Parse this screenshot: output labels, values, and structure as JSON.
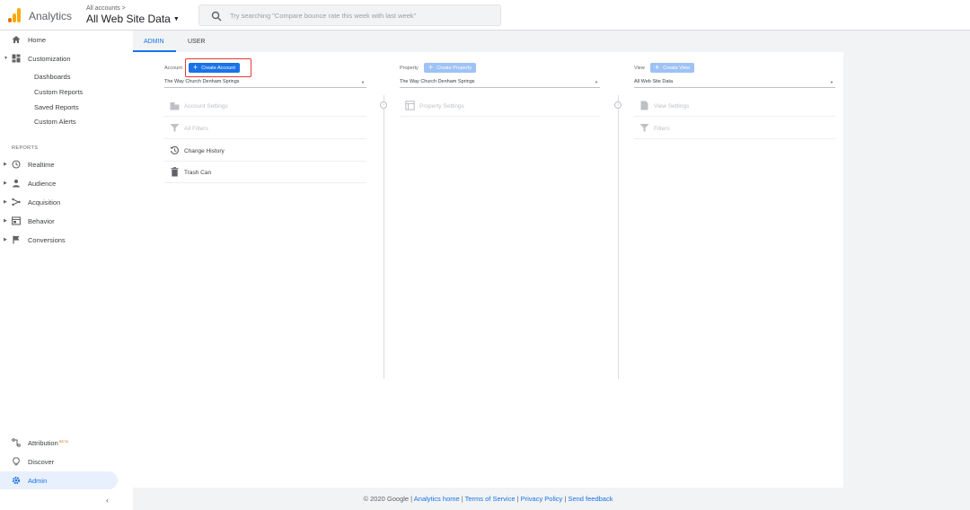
{
  "header": {
    "app_name": "Analytics",
    "account_crumb": "All accounts >",
    "account_title": "All Web Site Data",
    "search_placeholder": "Try searching \"Compare bounce rate this week with last week\""
  },
  "sidebar": {
    "home": "Home",
    "customization": "Customization",
    "custom_items": [
      "Dashboards",
      "Custom Reports",
      "Saved Reports",
      "Custom Alerts"
    ],
    "reports_label": "REPORTS",
    "reports": [
      "Realtime",
      "Audience",
      "Acquisition",
      "Behavior",
      "Conversions"
    ],
    "attribution": "Attribution",
    "attribution_badge": "BETA",
    "discover": "Discover",
    "admin": "Admin"
  },
  "tabs": {
    "admin": "ADMIN",
    "user": "USER"
  },
  "account_col": {
    "label": "Account",
    "button": "Create Account",
    "selected": "The Way Church Denham Springs",
    "items": [
      "Account Settings",
      "All Filters",
      "Change History",
      "Trash Can"
    ]
  },
  "property_col": {
    "label": "Property",
    "button": "Create Property",
    "selected": "The Way Church Denham Springs",
    "items": [
      "Property Settings"
    ]
  },
  "view_col": {
    "label": "View",
    "button": "Create View",
    "selected": "All Web Site Data",
    "items": [
      "View Settings",
      "Filters"
    ]
  },
  "footer": {
    "copyright": "© 2020 Google |",
    "links": [
      "Analytics home",
      "Terms of Service",
      "Privacy Policy",
      "Send feedback"
    ]
  },
  "colors": {
    "accent": "#1a73e8",
    "logo_orange": "#f9ab00",
    "logo_dark": "#e37400",
    "highlight": "#e53935"
  }
}
